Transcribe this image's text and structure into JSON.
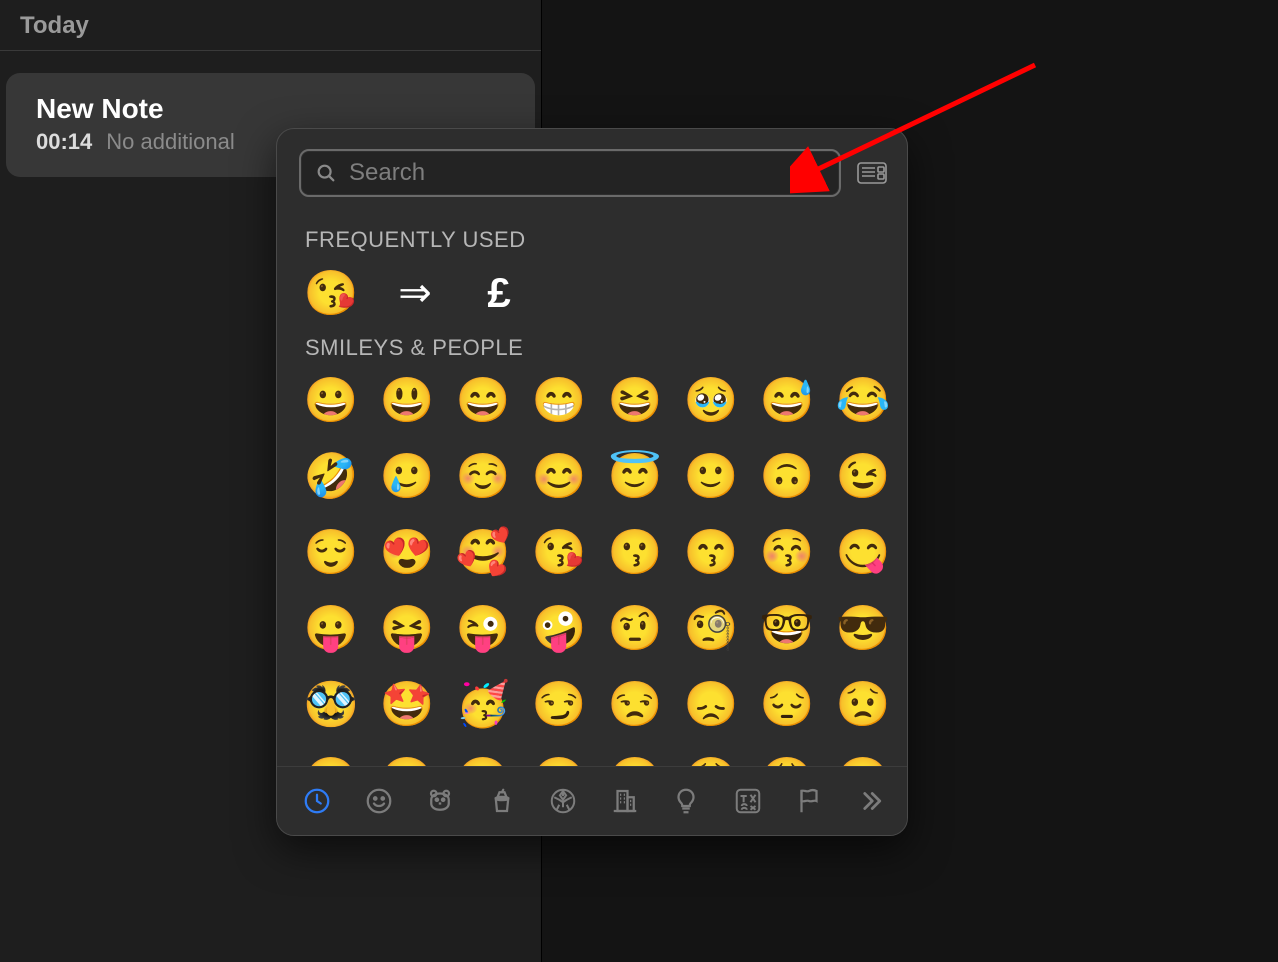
{
  "sidebar": {
    "section_label": "Today",
    "note": {
      "title": "New Note",
      "time": "00:14",
      "preview": "No additional"
    }
  },
  "picker": {
    "search_placeholder": "Search",
    "frequently_used_label": "FREQUENTLY USED",
    "frequently_used": [
      {
        "char": "😘",
        "name": "face-blowing-a-kiss"
      },
      {
        "char": "⇒",
        "name": "rightwards-double-arrow"
      },
      {
        "char": "£",
        "name": "pound-sign"
      }
    ],
    "smileys_label": "SMILEYS & PEOPLE",
    "smileys": [
      "😀",
      "😃",
      "😄",
      "😁",
      "😆",
      "🥹",
      "😅",
      "😂",
      "🤣",
      "🥲",
      "☺️",
      "😊",
      "😇",
      "🙂",
      "🙃",
      "😉",
      "😌",
      "😍",
      "🥰",
      "😘",
      "😗",
      "😙",
      "😚",
      "😋",
      "😛",
      "😝",
      "😜",
      "🤪",
      "🤨",
      "🧐",
      "🤓",
      "😎",
      "🥸",
      "🤩",
      "🥳",
      "😏",
      "😒",
      "😞",
      "😔",
      "😟",
      "😕",
      "🙁",
      "☹️",
      "😣",
      "😖",
      "😫",
      "😩",
      "🥺"
    ],
    "categories": [
      {
        "name": "recents",
        "icon": "clock",
        "active": true
      },
      {
        "name": "smileys",
        "icon": "smiley",
        "active": false
      },
      {
        "name": "animals",
        "icon": "bear",
        "active": false
      },
      {
        "name": "food",
        "icon": "cup",
        "active": false
      },
      {
        "name": "activity",
        "icon": "soccer",
        "active": false
      },
      {
        "name": "travel",
        "icon": "building",
        "active": false
      },
      {
        "name": "objects",
        "icon": "bulb",
        "active": false
      },
      {
        "name": "symbols",
        "icon": "symbols",
        "active": false
      },
      {
        "name": "flags",
        "icon": "flag",
        "active": false
      },
      {
        "name": "more",
        "icon": "chevrons",
        "active": false
      }
    ]
  }
}
